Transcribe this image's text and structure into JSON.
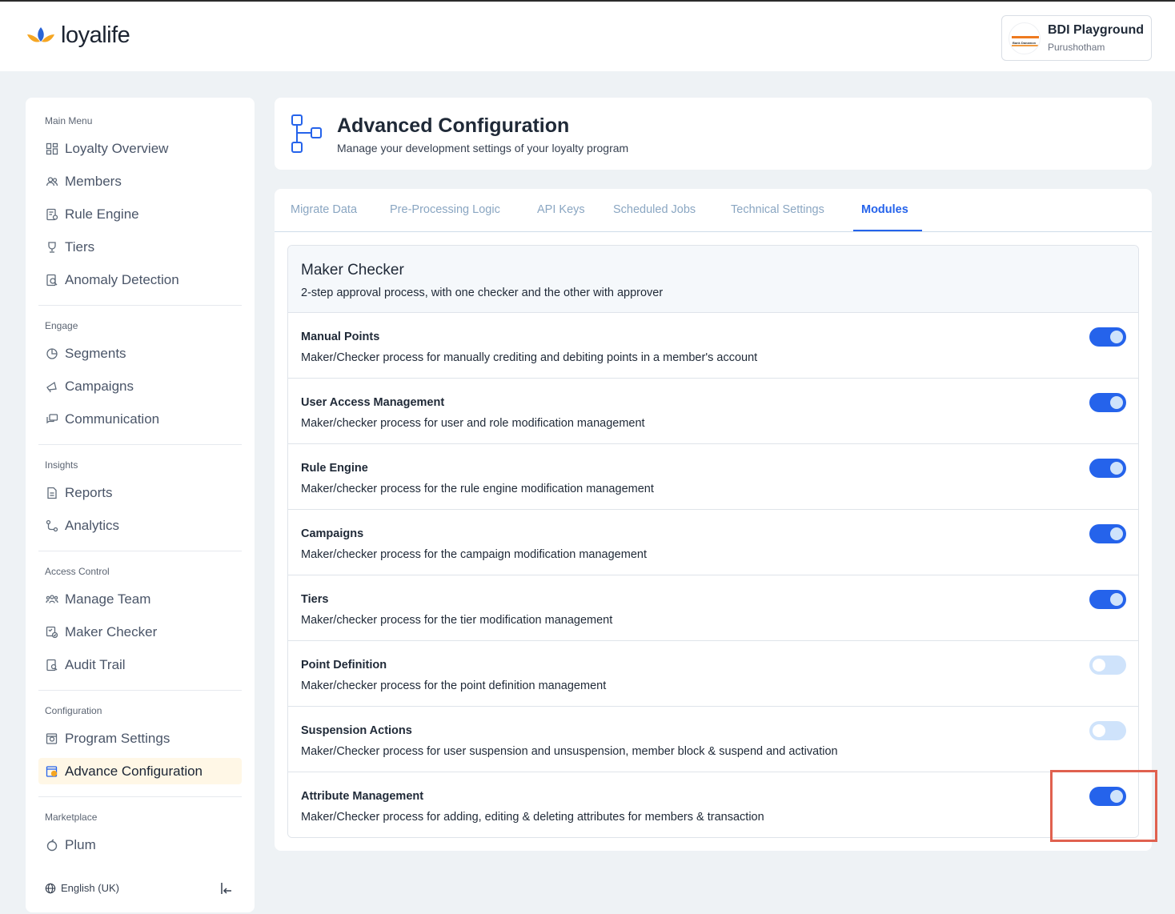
{
  "brand": {
    "name": "loyalife"
  },
  "org": {
    "logo_text": "Bank Danamon",
    "name": "BDI Playground",
    "user": "Purushotham"
  },
  "sidebar": {
    "sections": [
      {
        "title": "Main Menu",
        "items": [
          {
            "label": "Loyalty Overview",
            "icon": "grid-icon"
          },
          {
            "label": "Members",
            "icon": "users-icon"
          },
          {
            "label": "Rule Engine",
            "icon": "rule-doc-icon"
          },
          {
            "label": "Tiers",
            "icon": "trophy-icon"
          },
          {
            "label": "Anomaly Detection",
            "icon": "anomaly-icon"
          }
        ]
      },
      {
        "title": "Engage",
        "items": [
          {
            "label": "Segments",
            "icon": "pie-icon"
          },
          {
            "label": "Campaigns",
            "icon": "megaphone-icon"
          },
          {
            "label": "Communication",
            "icon": "chat-icon"
          }
        ]
      },
      {
        "title": "Insights",
        "items": [
          {
            "label": "Reports",
            "icon": "report-icon"
          },
          {
            "label": "Analytics",
            "icon": "analytics-icon"
          }
        ]
      },
      {
        "title": "Access Control",
        "items": [
          {
            "label": "Manage Team",
            "icon": "team-icon"
          },
          {
            "label": "Maker Checker",
            "icon": "maker-checker-icon"
          },
          {
            "label": "Audit Trail",
            "icon": "audit-icon"
          }
        ]
      },
      {
        "title": "Configuration",
        "items": [
          {
            "label": "Program Settings",
            "icon": "settings-icon"
          },
          {
            "label": "Advance Configuration",
            "icon": "advance-config-icon",
            "active": true
          }
        ]
      },
      {
        "title": "Marketplace",
        "items": [
          {
            "label": "Plum",
            "icon": "plum-icon"
          }
        ]
      }
    ],
    "language": "English (UK)"
  },
  "page": {
    "title": "Advanced Configuration",
    "subtitle": "Manage your development settings of your loyalty program"
  },
  "tabs": [
    {
      "label": "Migrate Data"
    },
    {
      "label": "Pre-Processing Logic"
    },
    {
      "label": "API Keys"
    },
    {
      "label": "Scheduled Jobs"
    },
    {
      "label": "Technical Settings"
    },
    {
      "label": "Modules",
      "active": true
    }
  ],
  "maker_checker": {
    "title": "Maker Checker",
    "description": "2-step approval process, with one checker and the other with approver",
    "modules": [
      {
        "title": "Manual Points",
        "description": "Maker/Checker process for manually crediting and debiting points in a member's account",
        "enabled": true
      },
      {
        "title": "User Access Management",
        "description": "Maker/checker process for user and role modification management",
        "enabled": true
      },
      {
        "title": "Rule Engine",
        "description": "Maker/checker process for the rule engine modification management",
        "enabled": true
      },
      {
        "title": "Campaigns",
        "description": "Maker/checker process for the campaign modification management",
        "enabled": true
      },
      {
        "title": "Tiers",
        "description": "Maker/checker process for the tier modification management",
        "enabled": true
      },
      {
        "title": "Point Definition",
        "description": "Maker/checker process for the point definition management",
        "enabled": false
      },
      {
        "title": "Suspension Actions",
        "description": "Maker/Checker process for user suspension and unsuspension, member block & suspend and activation",
        "enabled": false
      },
      {
        "title": "Attribute Management",
        "description": "Maker/Checker process for adding, editing & deleting attributes for members & transaction",
        "enabled": true
      }
    ]
  },
  "colors": {
    "accent": "#2563eb",
    "toggle_off": "#cfe3fb",
    "active_nav_bg": "#fff7e6",
    "highlight": "#e0614f"
  }
}
